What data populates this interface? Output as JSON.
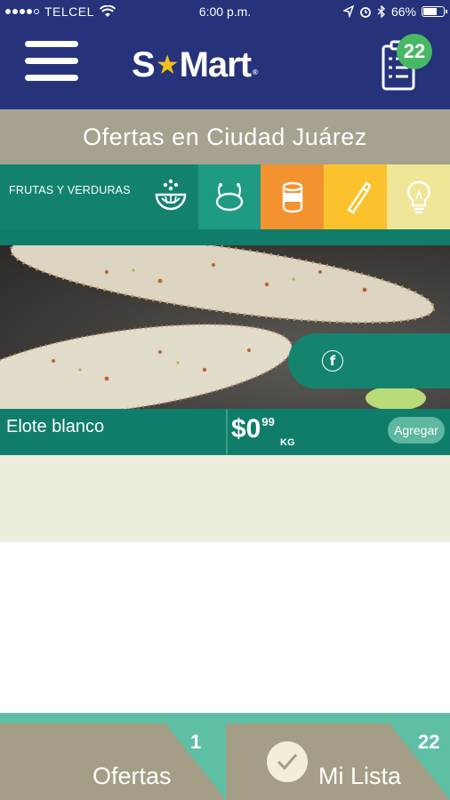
{
  "status_bar": {
    "carrier": "TELCEL",
    "time": "6:00 p.m.",
    "battery_text": "66%",
    "battery_level": 0.66
  },
  "header": {
    "logo_text": {
      "part1": "S",
      "part2": "Mart",
      "reg": "®"
    },
    "list_count": "22",
    "icons": [
      "menu-icon",
      "shopping-list-icon"
    ]
  },
  "title": "Ofertas en Ciudad Juárez",
  "categories": {
    "active": {
      "label": "FRUTAS Y VERDURAS",
      "icon": "fruit-bowl-icon",
      "color": "#12826e"
    },
    "tiles": [
      {
        "icon": "chicken-icon",
        "color": "#1e9b82"
      },
      {
        "icon": "can-icon",
        "color": "#f29330"
      },
      {
        "icon": "bottle-icon",
        "color": "#fbc22e"
      },
      {
        "icon": "lightbulb-icon",
        "color": "#efe797"
      }
    ]
  },
  "product": {
    "name": "Elote blanco",
    "price_main": "$0",
    "price_cents": "99",
    "price_unit": "KG",
    "add_label": "Agregar",
    "share_icon": "facebook-icon"
  },
  "bottom_nav": {
    "ofertas": {
      "label": "Ofertas",
      "count": "1"
    },
    "mi_lista": {
      "label": "Mi Lista",
      "count": "22",
      "icon": "checkmark-icon"
    }
  },
  "colors": {
    "header": "#26327a",
    "title_band": "#a6a28f",
    "product_bar": "#0f7d69",
    "add_button": "#5eb79f",
    "cream": "#efeede",
    "bottom_tab": "#a39e85",
    "bottom_accent": "#5ebfa5",
    "badge": "#47b866"
  }
}
